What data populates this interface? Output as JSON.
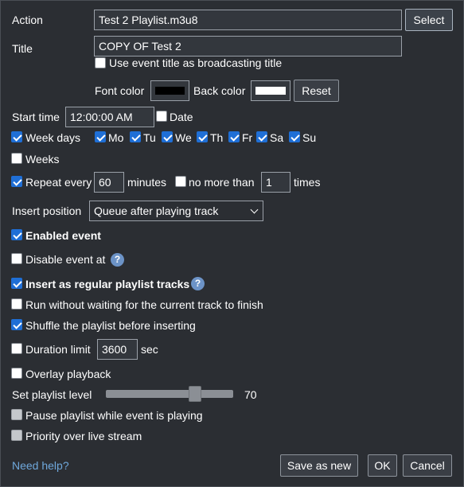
{
  "form": {
    "action_label": "Action",
    "action_value": "Test 2 Playlist.m3u8",
    "select_button": "Select",
    "title_label": "Title",
    "title_value": "COPY OF Test 2",
    "use_event_title": "Use event title as broadcasting title",
    "font_color_label": "Font color",
    "back_color_label": "Back color",
    "reset_button": "Reset",
    "font_color": "#000000",
    "back_color": "#ffffff",
    "start_time_label": "Start time",
    "start_time_value": "12:00:00 AM",
    "date_label": "Date",
    "week_days_label": "Week days",
    "days": [
      "Mo",
      "Tu",
      "We",
      "Th",
      "Fr",
      "Sa",
      "Su"
    ],
    "weeks_label": "Weeks",
    "repeat_every_label": "Repeat every",
    "repeat_value": "60",
    "minutes_label": "minutes",
    "no_more_than_label": "no more than",
    "times_value": "1",
    "times_label": "times",
    "insert_position_label": "Insert position",
    "insert_position_value": "Queue after playing track",
    "enabled_event": "Enabled event",
    "disable_event_at": "Disable event at",
    "insert_regular": "Insert as regular playlist tracks",
    "run_without_waiting": "Run without waiting for the current track to finish",
    "shuffle": "Shuffle the playlist before inserting",
    "duration_limit_label": "Duration limit",
    "duration_value": "3600",
    "sec_label": "sec",
    "overlay_playback": "Overlay playback",
    "playlist_level_label": "Set playlist level",
    "playlist_level_value": "70",
    "playlist_level_fraction": 0.7,
    "pause_playlist": "Pause playlist while event is playing",
    "priority_live": "Priority over live stream",
    "help_glyph": "?"
  },
  "footer": {
    "need_help": "Need help?",
    "save_as_new": "Save as new",
    "ok": "OK",
    "cancel": "Cancel"
  },
  "colors": {
    "background": "#2b2e33",
    "checkbox_checked": "#1f6fd6",
    "link": "#6fa8dc",
    "help_badge": "#6c93c7"
  }
}
